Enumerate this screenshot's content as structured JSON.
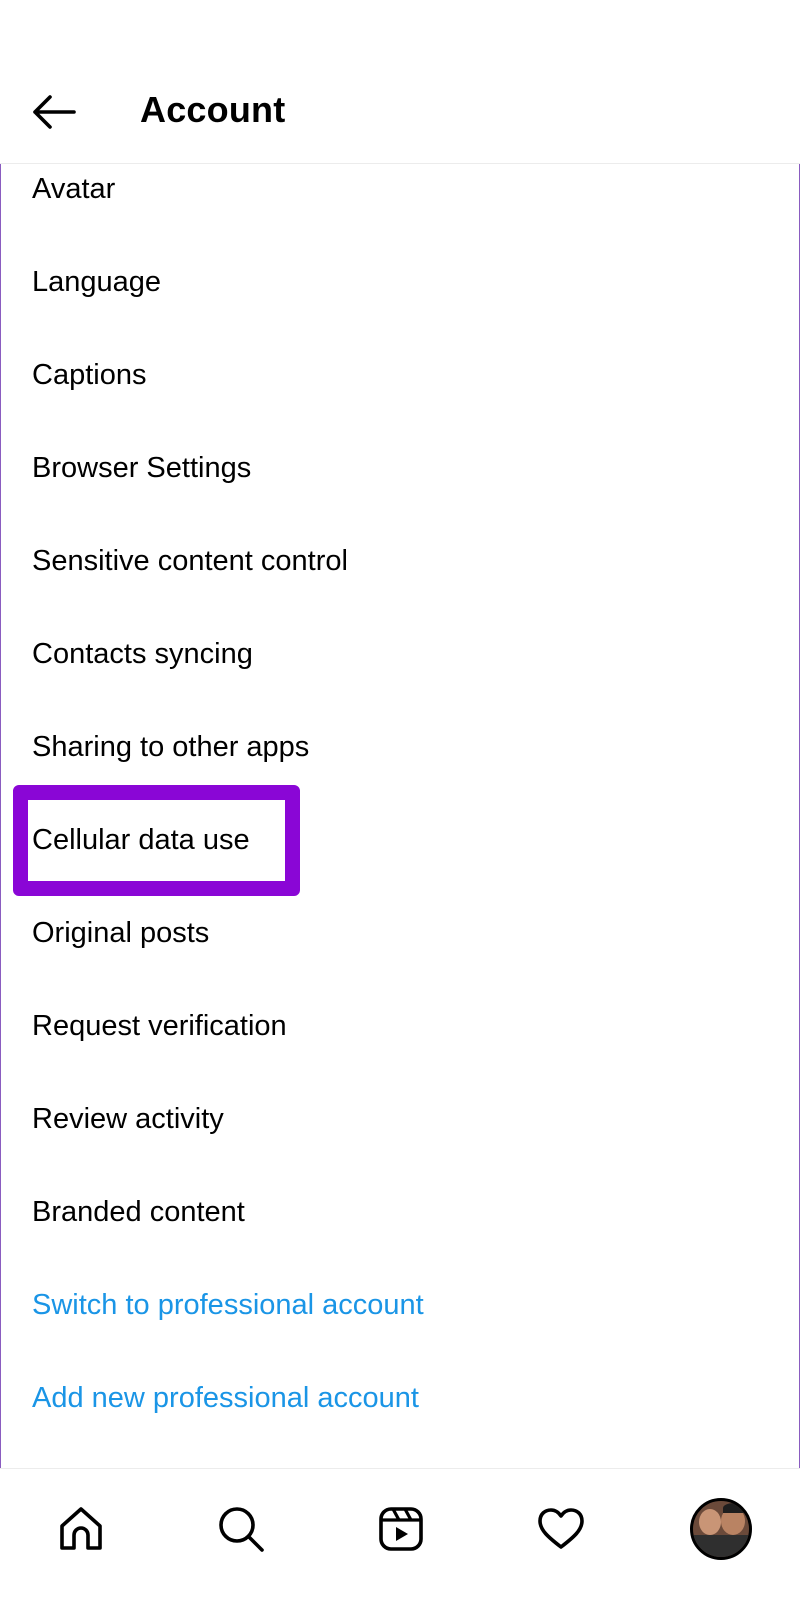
{
  "header": {
    "title": "Account",
    "back_icon": "arrow-left-icon"
  },
  "menu": {
    "items": [
      {
        "label": "Avatar"
      },
      {
        "label": "Language"
      },
      {
        "label": "Captions"
      },
      {
        "label": "Browser Settings"
      },
      {
        "label": "Sensitive content control"
      },
      {
        "label": "Contacts syncing"
      },
      {
        "label": "Sharing to other apps"
      },
      {
        "label": "Cellular data use"
      },
      {
        "label": "Original posts"
      },
      {
        "label": "Request verification"
      },
      {
        "label": "Review activity"
      },
      {
        "label": "Branded content"
      },
      {
        "label": "Switch to professional account"
      },
      {
        "label": "Add new professional account"
      }
    ]
  },
  "highlight": {
    "target": "Cellular data use",
    "color": "#8a06d6"
  },
  "colors": {
    "link": "#1a95e6",
    "text": "#000000",
    "divider": "#ececec"
  },
  "bottom_nav": {
    "icons": [
      "home-icon",
      "search-icon",
      "reels-icon",
      "heart-icon",
      "profile-avatar"
    ]
  }
}
